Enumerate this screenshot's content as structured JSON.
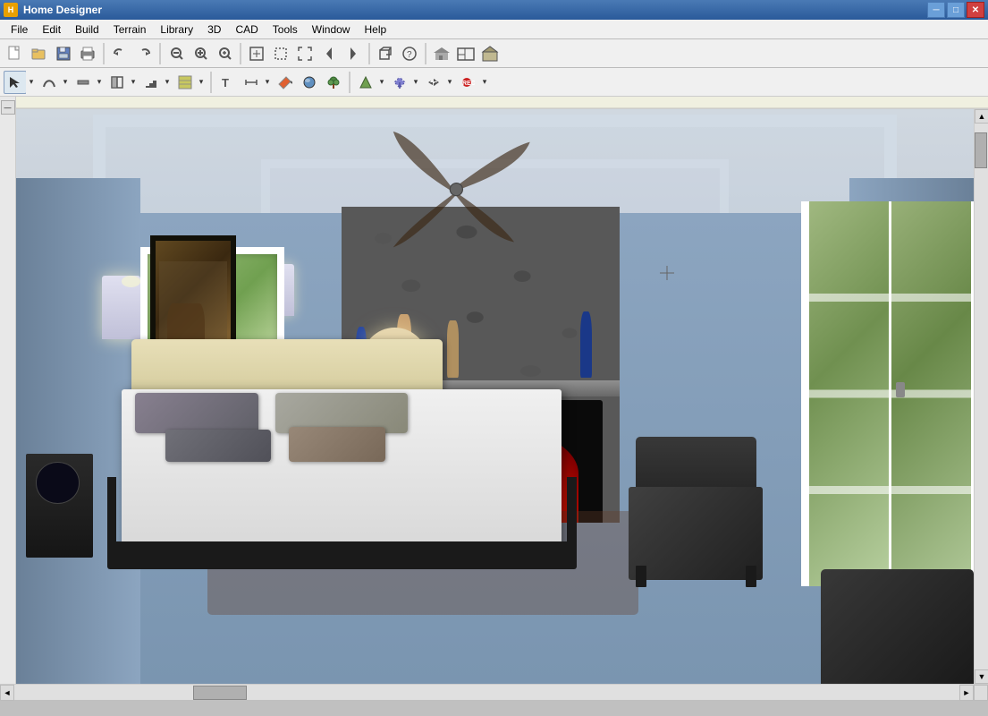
{
  "window": {
    "title": "Home Designer",
    "icon": "HD"
  },
  "titlebar": {
    "minimize": "─",
    "maximize": "□",
    "close": "✕"
  },
  "menu": {
    "items": [
      "File",
      "Edit",
      "Build",
      "Terrain",
      "Library",
      "3D",
      "CAD",
      "Tools",
      "Window",
      "Help"
    ]
  },
  "toolbar1": {
    "buttons": [
      {
        "name": "new",
        "icon": "📄"
      },
      {
        "name": "open",
        "icon": "📂"
      },
      {
        "name": "save",
        "icon": "💾"
      },
      {
        "name": "print",
        "icon": "🖨"
      },
      {
        "name": "undo",
        "icon": "↩"
      },
      {
        "name": "redo",
        "icon": "↪"
      },
      {
        "name": "zoom-out",
        "icon": "🔍"
      },
      {
        "name": "zoom-in-real",
        "icon": "⊕"
      },
      {
        "name": "zoom-in",
        "icon": "⊖"
      },
      {
        "name": "zoom-fit",
        "icon": "⊞"
      },
      {
        "name": "zoom-sel",
        "icon": "⊡"
      },
      {
        "name": "pan-full",
        "icon": "⛶"
      },
      {
        "name": "arrows",
        "icon": "⇱"
      },
      {
        "name": "up-arrow",
        "icon": "↑"
      },
      {
        "name": "3d-view",
        "icon": "▣"
      },
      {
        "name": "help",
        "icon": "?"
      },
      {
        "name": "sep1",
        "icon": "|"
      },
      {
        "name": "house1",
        "icon": "⌂"
      },
      {
        "name": "house2",
        "icon": "⌂"
      },
      {
        "name": "house3",
        "icon": "⌂"
      }
    ]
  },
  "toolbar2": {
    "buttons": [
      {
        "name": "select",
        "icon": "↖"
      },
      {
        "name": "spline",
        "icon": "∿"
      },
      {
        "name": "wall",
        "icon": "━"
      },
      {
        "name": "door-win",
        "icon": "▦"
      },
      {
        "name": "stair",
        "icon": "⊟"
      },
      {
        "name": "floor",
        "icon": "▩"
      },
      {
        "name": "text",
        "icon": "T"
      },
      {
        "name": "dim",
        "icon": "⟷"
      },
      {
        "name": "paint",
        "icon": "🎨"
      },
      {
        "name": "material",
        "icon": "M"
      },
      {
        "name": "plant",
        "icon": "❋"
      },
      {
        "name": "terrain",
        "icon": "▲"
      },
      {
        "name": "fill",
        "icon": "↑"
      },
      {
        "name": "move",
        "icon": "✛"
      },
      {
        "name": "rec",
        "icon": "⬤"
      }
    ]
  },
  "room": {
    "description": "3D bedroom render with fireplace",
    "scene_type": "interior_3d"
  },
  "scrollbar": {
    "h_label": "◄",
    "h_right": "►",
    "v_up": "▲",
    "v_down": "▼"
  }
}
